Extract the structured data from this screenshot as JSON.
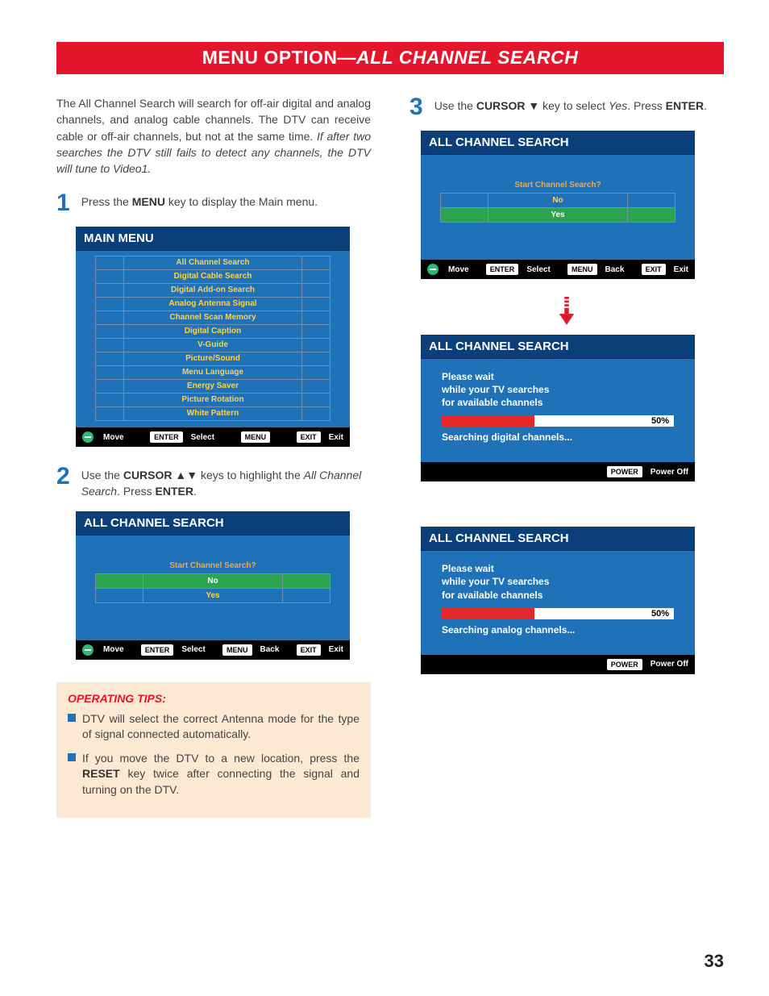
{
  "banner": {
    "prefix": "MENU OPTION—",
    "title": "ALL CHANNEL SEARCH"
  },
  "intro": {
    "text": "The All Channel Search will search for off-air digital and analog channels, and analog cable channels. The DTV can receive cable or off-air channels, but not at the same time.",
    "italic": "If after two searches the DTV still fails to detect any channels, the DTV will tune to Video1."
  },
  "steps": {
    "s1": {
      "num": "1",
      "pre": "Press the ",
      "key": "MENU",
      "post": " key to display the Main menu."
    },
    "s2": {
      "num": "2",
      "pre": "Use the ",
      "key": "CURSOR ▲▼",
      "mid": " keys to highlight the ",
      "ital": "All Channel Search",
      "post": ". Press ",
      "key2": "ENTER",
      "post2": "."
    },
    "s3": {
      "num": "3",
      "pre": "Use the ",
      "key": "CURSOR ▼",
      "mid": " key to select ",
      "ital": "Yes",
      "post": ". Press ",
      "key2": "ENTER",
      "post2": "."
    }
  },
  "main_menu": {
    "title": "MAIN MENU",
    "items": [
      "All Channel Search",
      "Digital Cable Search",
      "Digital Add-on Search",
      "Analog Antenna Signal",
      "Channel Scan Memory",
      "Digital Caption",
      "V-Guide",
      "Picture/Sound",
      "Menu Language",
      "Energy Saver",
      "Picture Rotation",
      "White Pattern"
    ],
    "footer": {
      "move": "Move",
      "enter": "ENTER",
      "select": "Select",
      "menu": "MENU",
      "exit_btn": "EXIT",
      "exit": "Exit"
    }
  },
  "search_screen": {
    "title": "ALL CHANNEL SEARCH",
    "prompt": "Start Channel Search?",
    "no": "No",
    "yes": "Yes",
    "footer": {
      "move": "Move",
      "enter": "ENTER",
      "select": "Select",
      "menu": "MENU",
      "back": "Back",
      "exit_btn": "EXIT",
      "exit": "Exit"
    },
    "selected": "no"
  },
  "search_screen2": {
    "title": "ALL CHANNEL SEARCH",
    "prompt": "Start Channel Search?",
    "no": "No",
    "yes": "Yes",
    "footer": {
      "move": "Move",
      "enter": "ENTER",
      "select": "Select",
      "menu": "MENU",
      "back": "Back",
      "exit_btn": "EXIT",
      "exit": "Exit"
    },
    "selected": "yes"
  },
  "progress1": {
    "title": "ALL CHANNEL SEARCH",
    "line1": "Please wait",
    "line2": "while your TV searches",
    "line3": "for available channels",
    "pct": "50%",
    "status": "Searching digital channels...",
    "footer": {
      "power_btn": "POWER",
      "power": "Power Off"
    }
  },
  "progress2": {
    "title": "ALL CHANNEL SEARCH",
    "line1": "Please wait",
    "line2": "while your TV searches",
    "line3": "for available channels",
    "pct": "50%",
    "status": "Searching analog channels...",
    "footer": {
      "power_btn": "POWER",
      "power": "Power Off"
    }
  },
  "tips": {
    "heading": "OPERATING TIPS:",
    "t1": "DTV will select the correct Antenna mode for the type of signal connected automatically.",
    "t2a": "If you move the DTV to a new location, press the ",
    "t2key": "RESET",
    "t2b": " key twice after connecting the signal and turning on the DTV."
  },
  "page_number": "33"
}
